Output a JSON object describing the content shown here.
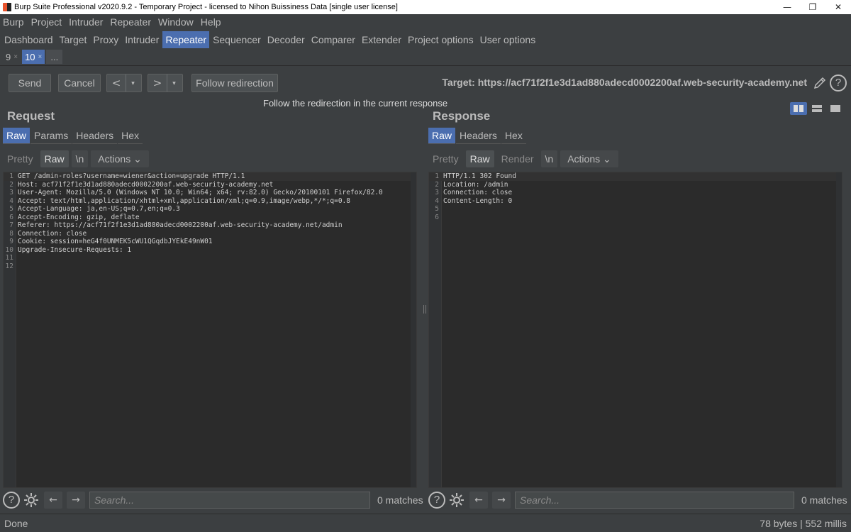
{
  "window": {
    "title": "Burp Suite Professional v2020.9.2 - Temporary Project - licensed to Nihon Buissiness Data [single user license]",
    "minimize": "—",
    "restore": "❐",
    "close": "✕"
  },
  "menubar": [
    "Burp",
    "Project",
    "Intruder",
    "Repeater",
    "Window",
    "Help"
  ],
  "main_tabs": {
    "items": [
      "Dashboard",
      "Target",
      "Proxy",
      "Intruder",
      "Repeater",
      "Sequencer",
      "Decoder",
      "Comparer",
      "Extender",
      "Project options",
      "User options"
    ],
    "active": "Repeater"
  },
  "repeater_tabs": {
    "items": [
      {
        "label": "9",
        "close": "×"
      },
      {
        "label": "10",
        "close": "×"
      }
    ],
    "active": "10",
    "more": "..."
  },
  "toolbar": {
    "send": "Send",
    "cancel": "Cancel",
    "back": "<",
    "forward": ">",
    "dropdown": "▾",
    "follow": "Follow redirection",
    "target": "Target: https://acf71f2f1e3d1ad880adecd0002200af.web-security-academy.net",
    "help": "?"
  },
  "tooltip": "Follow the redirection in the current response",
  "request": {
    "title": "Request",
    "tabs": [
      "Raw",
      "Params",
      "Headers",
      "Hex"
    ],
    "active_tab": "Raw",
    "view": {
      "pretty": "Pretty",
      "raw": "Raw",
      "newline": "\\n",
      "actions": "Actions ⌄"
    },
    "lines": [
      {
        "n": "1",
        "text": "GET /admin-roles?username=wiener&action=upgrade HTTP/1.1"
      },
      {
        "n": "2",
        "text": "Host: acf71f2f1e3d1ad880adecd0002200af.web-security-academy.net"
      },
      {
        "n": "3",
        "text": "User-Agent: Mozilla/5.0 (Windows NT 10.0; Win64; x64; rv:82.0) Gecko/20100101 Firefox/82.0"
      },
      {
        "n": "4",
        "text": "Accept: text/html,application/xhtml+xml,application/xml;q=0.9,image/webp,*/*;q=0.8"
      },
      {
        "n": "5",
        "text": "Accept-Language: ja,en-US;q=0.7,en;q=0.3"
      },
      {
        "n": "6",
        "text": "Accept-Encoding: gzip, deflate"
      },
      {
        "n": "7",
        "text": "Referer: https://acf71f2f1e3d1ad880adecd0002200af.web-security-academy.net/admin"
      },
      {
        "n": "8",
        "text": "Connection: close"
      },
      {
        "n": "9",
        "text": "Cookie: session=heG4f0UNMEK5cWU1QGqdbJYEkE49nW01"
      },
      {
        "n": "10",
        "text": "Upgrade-Insecure-Requests: 1"
      },
      {
        "n": "11",
        "text": ""
      },
      {
        "n": "12",
        "text": ""
      }
    ],
    "search_placeholder": "Search...",
    "matches": "0 matches"
  },
  "response": {
    "title": "Response",
    "tabs": [
      "Raw",
      "Headers",
      "Hex"
    ],
    "active_tab": "Raw",
    "view": {
      "pretty": "Pretty",
      "raw": "Raw",
      "render": "Render",
      "newline": "\\n",
      "actions": "Actions ⌄"
    },
    "lines": [
      {
        "n": "1",
        "text": "HTTP/1.1 302 Found"
      },
      {
        "n": "2",
        "text": "Location: /admin"
      },
      {
        "n": "3",
        "text": "Connection: close"
      },
      {
        "n": "4",
        "text": "Content-Length: 0"
      },
      {
        "n": "5",
        "text": ""
      },
      {
        "n": "6",
        "text": ""
      }
    ],
    "search_placeholder": "Search...",
    "matches": "0 matches"
  },
  "status": {
    "left": "Done",
    "right": "78 bytes | 552 millis"
  },
  "colors": {
    "accent": "#4b6eaf",
    "background": "#3c3f41",
    "editor": "#2b2b2b",
    "param_highlight": "#a5c25c"
  }
}
